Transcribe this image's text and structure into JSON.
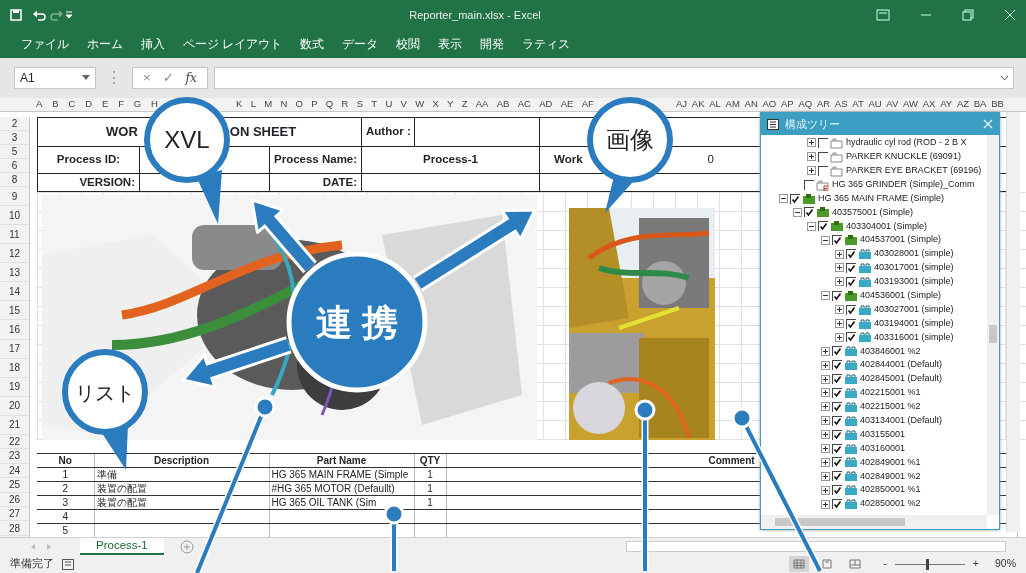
{
  "window": {
    "title": "Reporter_main.xlsx - Excel"
  },
  "ribbon_tabs": [
    "ファイル",
    "ホーム",
    "挿入",
    "ページ レイアウト",
    "数式",
    "データ",
    "校閲",
    "表示",
    "開発",
    "ラティス"
  ],
  "formula_bar": {
    "name_box": "A1",
    "more": "⋮",
    "cancel": "×",
    "enter": "✓",
    "function": "fx"
  },
  "column_headers": [
    [
      "A",
      "B",
      "C",
      "D",
      "E",
      "F",
      "G",
      "H"
    ],
    [
      "K",
      "L",
      "M",
      "N",
      "O",
      "P",
      "Q",
      "R",
      "S",
      "T",
      "U",
      "V",
      "W",
      "X",
      "Y",
      "Z",
      "AA",
      "AB",
      "AC",
      "AD",
      "AE",
      "AF"
    ],
    [
      "AJ",
      "AK",
      "AL",
      "AM",
      "AN",
      "AO",
      "AP",
      "AQ",
      "AR",
      "AS",
      "AT",
      "AU",
      "AV",
      "AW",
      "AX",
      "AY",
      "AZ",
      "BA",
      "BB"
    ]
  ],
  "rows": [
    {
      "number": "2",
      "kind": "form"
    },
    {
      "number": "3",
      "kind": "form"
    },
    {
      "number": "5",
      "kind": "form"
    },
    {
      "number": "6",
      "kind": "form"
    },
    {
      "number": "8",
      "kind": "form"
    },
    {
      "number": "9"
    },
    {
      "number": "10"
    },
    {
      "number": "11"
    },
    {
      "number": "12"
    },
    {
      "number": "13"
    },
    {
      "number": "14"
    },
    {
      "number": "15"
    },
    {
      "number": "16"
    },
    {
      "number": "17"
    },
    {
      "number": "18"
    },
    {
      "number": "19"
    },
    {
      "number": "20"
    },
    {
      "number": "21"
    },
    {
      "number": "22",
      "kind": "table"
    },
    {
      "number": "23",
      "kind": "table"
    },
    {
      "number": "24",
      "kind": "table"
    },
    {
      "number": "25",
      "kind": "table"
    },
    {
      "number": "26",
      "kind": "table"
    },
    {
      "number": "27",
      "kind": "table"
    },
    {
      "number": "28",
      "kind": "table"
    }
  ],
  "form": {
    "title_parts": [
      "WOR",
      "ON SHEET"
    ],
    "author_label": "Author :",
    "process_id_label": "Process ID:",
    "process_name_label": "Process Name:",
    "process_name": "Process-1",
    "work_label": "Work",
    "work_value": "0",
    "version_label": "VERSION:",
    "date_label": "DATE:"
  },
  "parts_table": {
    "columns": [
      "No",
      "Description",
      "Part Name",
      "QTY",
      "Comment"
    ],
    "rows": [
      {
        "no": "1",
        "description": "準備",
        "part_name": "HG 365 MAIN FRAME (Simple",
        "qty": "1"
      },
      {
        "no": "2",
        "description": "装置の配置",
        "part_name": "#HG 365 MOTOR (Defaullt)",
        "qty": "1"
      },
      {
        "no": "3",
        "description": "装置の配置",
        "part_name": "HG 365 OIL TANK (Sim",
        "qty": "1"
      },
      {
        "no": "4"
      },
      {
        "no": "5"
      }
    ]
  },
  "sheet_tabs": [
    {
      "label": "Process-1",
      "selected": true
    }
  ],
  "status_bar": {
    "text": "準備完了",
    "views": [
      {
        "kind": "normal",
        "selected": true
      },
      {
        "kind": "layout",
        "selected": false
      },
      {
        "kind": "break",
        "selected": false
      }
    ],
    "zoom": {
      "minus": "-",
      "plus": "+",
      "level": 0.45,
      "reading": "90%"
    }
  },
  "tree_panel": {
    "title": "構成ツリー",
    "items": [
      {
        "children": [
          {
            "children": [
              {
                "label": "hydraulic cyl rod (ROD - 2 B X",
                "kind": "empty",
                "checked": false,
                "expanded": false
              },
              {
                "label": "PARKER KNUCKLE (69091)",
                "kind": "empty",
                "checked": false,
                "expanded": false
              },
              {
                "label": "PARKER EYE BRACKET (69196)",
                "kind": "empty",
                "checked": false,
                "expanded": false
              }
            ]
          },
          {
            "label": "HG 365 GRINDER (Simple)_Comm",
            "kind": "note",
            "checked": false
          }
        ]
      },
      {
        "label": "HG 365 MAIN FRAME (Simple)",
        "kind": "assembly",
        "checked": true,
        "expanded": true,
        "children": [
          {
            "label": "403575001 (Simple)",
            "kind": "assembly",
            "checked": true,
            "expanded": true,
            "children": [
              {
                "label": "403304001 (Simple)",
                "kind": "assembly",
                "checked": true,
                "expanded": true,
                "children": [
                  {
                    "label": "404537001 (Simple)",
                    "kind": "assembly",
                    "checked": true,
                    "expanded": true,
                    "children": [
                      {
                        "label": "403028001 (simple)",
                        "kind": "part",
                        "checked": true,
                        "expanded": false
                      },
                      {
                        "label": "403017001 (simple)",
                        "kind": "part",
                        "checked": true,
                        "expanded": false
                      },
                      {
                        "label": "403193001 (simple)",
                        "kind": "part",
                        "checked": true,
                        "expanded": false
                      }
                    ]
                  },
                  {
                    "label": "404536001 (Simple)",
                    "kind": "assembly",
                    "checked": true,
                    "expanded": true,
                    "children": [
                      {
                        "label": "403027001 (simple)",
                        "kind": "part",
                        "checked": true,
                        "expanded": false
                      },
                      {
                        "label": "403194001 (simple)",
                        "kind": "part",
                        "checked": true,
                        "expanded": false
                      },
                      {
                        "label": "403316001 (simple)",
                        "kind": "part",
                        "checked": true,
                        "expanded": false
                      }
                    ]
                  },
                  {
                    "label": "403846001 %2",
                    "kind": "part",
                    "checked": true,
                    "expanded": false
                  },
                  {
                    "label": "402844001 (Default)",
                    "kind": "part",
                    "checked": true,
                    "expanded": false
                  },
                  {
                    "label": "402845001 (Default)",
                    "kind": "part",
                    "checked": true,
                    "expanded": false
                  },
                  {
                    "label": "402215001 %1",
                    "kind": "part",
                    "checked": true,
                    "expanded": false
                  },
                  {
                    "label": "402215001 %2",
                    "kind": "part",
                    "checked": true,
                    "expanded": false
                  },
                  {
                    "label": "403134001 (Default)",
                    "kind": "part",
                    "checked": true,
                    "expanded": false
                  },
                  {
                    "label": "403155001",
                    "kind": "part",
                    "checked": true,
                    "expanded": false
                  },
                  {
                    "label": "403160001",
                    "kind": "part",
                    "checked": true,
                    "expanded": false
                  },
                  {
                    "label": "402849001 %1",
                    "kind": "part",
                    "checked": true,
                    "expanded": false
                  },
                  {
                    "label": "402849001 %2",
                    "kind": "part",
                    "checked": true,
                    "expanded": false
                  },
                  {
                    "label": "402850001 %1",
                    "kind": "part",
                    "checked": true,
                    "expanded": false
                  },
                  {
                    "label": "402850001 %2",
                    "kind": "part",
                    "checked": true,
                    "expanded": false
                  }
                ]
              }
            ]
          }
        ]
      }
    ]
  },
  "callouts": [
    {
      "kind": "bubble",
      "label": "XVL"
    },
    {
      "kind": "bubble",
      "label": "画像"
    },
    {
      "kind": "bubble",
      "label": "リスト"
    },
    {
      "kind": "hub",
      "label": "連 携"
    }
  ]
}
